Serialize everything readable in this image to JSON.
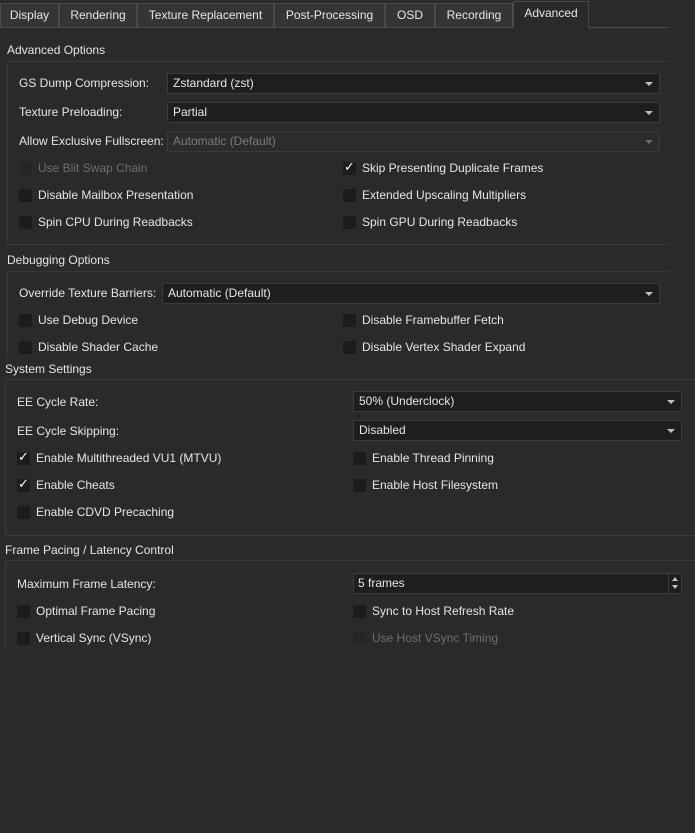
{
  "tabs": [
    {
      "label": "Display"
    },
    {
      "label": "Rendering"
    },
    {
      "label": "Texture Replacement"
    },
    {
      "label": "Post-Processing"
    },
    {
      "label": "OSD"
    },
    {
      "label": "Recording"
    },
    {
      "label": "Advanced"
    }
  ],
  "active_tab": "Advanced",
  "advanced": {
    "title": "Advanced Options",
    "gs_dump": {
      "label": "GS Dump Compression:",
      "value": "Zstandard (zst)"
    },
    "texture_preload": {
      "label": "Texture Preloading:",
      "value": "Partial"
    },
    "exclusive_fs": {
      "label": "Allow Exclusive Fullscreen:",
      "value": "Automatic (Default)",
      "enabled": false
    },
    "checks": [
      {
        "label": "Use Blit Swap Chain",
        "checked": false,
        "enabled": false
      },
      {
        "label": "Skip Presenting Duplicate Frames",
        "checked": true,
        "enabled": true
      },
      {
        "label": "Disable Mailbox Presentation",
        "checked": false,
        "enabled": true
      },
      {
        "label": "Extended Upscaling Multipliers",
        "checked": false,
        "enabled": true
      },
      {
        "label": "Spin CPU During Readbacks",
        "checked": false,
        "enabled": true
      },
      {
        "label": "Spin GPU During Readbacks",
        "checked": false,
        "enabled": true
      }
    ]
  },
  "debugging": {
    "title": "Debugging Options",
    "barriers": {
      "label": "Override Texture Barriers:",
      "value": "Automatic (Default)"
    },
    "checks": [
      {
        "label": "Use Debug Device",
        "checked": false,
        "enabled": true
      },
      {
        "label": "Disable Framebuffer Fetch",
        "checked": false,
        "enabled": true
      },
      {
        "label": "Disable Shader Cache",
        "checked": false,
        "enabled": true
      },
      {
        "label": "Disable Vertex Shader Expand",
        "checked": false,
        "enabled": true
      }
    ]
  },
  "system": {
    "title": "System Settings",
    "ee_cycle_rate": {
      "label": "EE Cycle Rate:",
      "value": "50% (Underclock)"
    },
    "ee_cycle_skip": {
      "label": "EE Cycle Skipping:",
      "value": "Disabled"
    },
    "checks": [
      {
        "label": "Enable Multithreaded VU1 (MTVU)",
        "checked": true,
        "enabled": true
      },
      {
        "label": "Enable Thread Pinning",
        "checked": false,
        "enabled": true
      },
      {
        "label": "Enable Cheats",
        "checked": true,
        "enabled": true
      },
      {
        "label": "Enable Host Filesystem",
        "checked": false,
        "enabled": true
      },
      {
        "label": "Enable CDVD Precaching",
        "checked": false,
        "enabled": true
      }
    ]
  },
  "pacing": {
    "title": "Frame Pacing / Latency Control",
    "max_latency": {
      "label": "Maximum Frame Latency:",
      "value": "5 frames"
    },
    "checks": [
      {
        "label": "Optimal Frame Pacing",
        "checked": false,
        "enabled": true
      },
      {
        "label": "Sync to Host Refresh Rate",
        "checked": false,
        "enabled": true
      },
      {
        "label": "Vertical Sync (VSync)",
        "checked": false,
        "enabled": true
      },
      {
        "label": "Use Host VSync Timing",
        "checked": false,
        "enabled": false
      }
    ]
  },
  "icons": {
    "check": "✓"
  }
}
